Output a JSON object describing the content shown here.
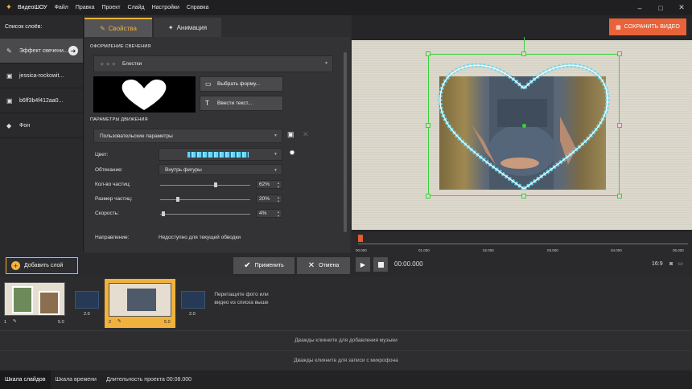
{
  "app": {
    "name": "ВидеоШОУ"
  },
  "menu": [
    "Файл",
    "Правка",
    "Проект",
    "Слайд",
    "Настройки",
    "Справка"
  ],
  "window_controls": [
    "–",
    "□",
    "✕"
  ],
  "layers": {
    "header": "Список слоёв:",
    "items": [
      {
        "label": "Эффект свечени...",
        "icon": "wand-icon"
      },
      {
        "label": "jessica-rockowit...",
        "icon": "image-icon"
      },
      {
        "label": "b6ff3b4f412aa0...",
        "icon": "image-icon"
      },
      {
        "label": "Фон",
        "icon": "paint-bucket-icon"
      }
    ]
  },
  "tabs": [
    {
      "label": "Свойства",
      "active": true
    },
    {
      "label": "Анимация",
      "active": false
    }
  ],
  "props": {
    "glow_section": "ОФОРМЛЕНИЕ СВЕЧЕНИЯ",
    "effect_value": "Блестки",
    "choose_shape": "Выбрать форму...",
    "enter_text": "Ввести текст...",
    "motion_section": "ПАРАМЕТРЫ ДВИЖЕНИЯ",
    "preset_value": "Пользовательские параметры",
    "color_label": "Цвет:",
    "wrap_label": "Обтекание:",
    "wrap_value": "Внутрь фигуры",
    "count_label": "Кол-во частиц:",
    "count_value": "62%",
    "count_level": 0.62,
    "size_label": "Размер частиц:",
    "size_value": "20%",
    "size_level": 0.2,
    "speed_label": "Скорость:",
    "speed_value": "4%",
    "speed_level": 0.04,
    "direction_label": "Направление:",
    "direction_value": "Недоступно для текущей обводки"
  },
  "save_button": "СОХРАНИТЬ ВИДЕО",
  "ruler_ticks": [
    "00.000",
    "01.000",
    "02.000",
    "03.000",
    "04.000",
    "05.000"
  ],
  "toolbar": {
    "add_layer": "Добавить слой",
    "apply": "Применить",
    "cancel": "Отмена",
    "timecode": "00:00.000",
    "aspect": "16:9"
  },
  "slides": [
    {
      "num": "1",
      "duration": "5.0"
    },
    {
      "num": "2",
      "duration": "5.0"
    }
  ],
  "transitions": [
    {
      "duration": "2.0"
    },
    {
      "duration": "2.0"
    }
  ],
  "drop_hint": "Перетащите фото или видео из списка выше",
  "audio_rows": [
    "Дважды кликните для добавления музыки",
    "Дважды кликните для записи с микрофона"
  ],
  "status": {
    "slides_tab": "Шкала слайдов",
    "timeline_tab": "Шкала времени",
    "duration": "Длительность проекта 00:08.000"
  },
  "colors": {
    "accent": "#f0b23c",
    "save": "#e8623a",
    "selection": "#3bd13b",
    "glow": "#5fd8f0"
  }
}
